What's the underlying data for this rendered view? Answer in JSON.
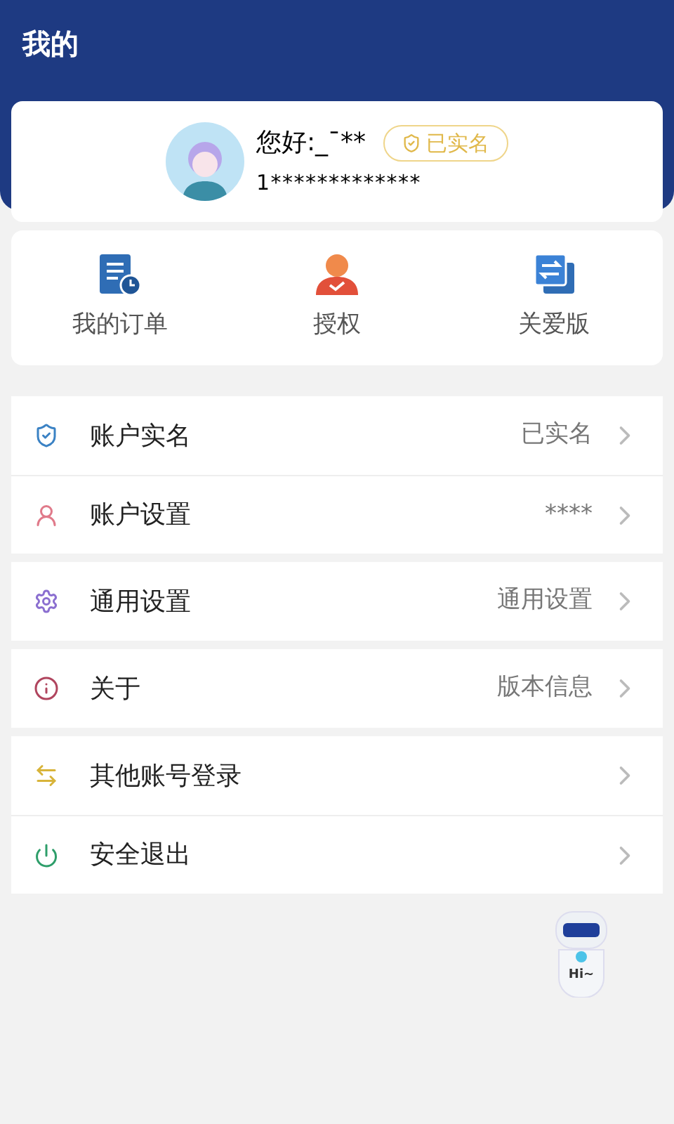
{
  "header": {
    "title": "我的"
  },
  "profile": {
    "greeting": "您好:_ˉ**",
    "verified": true,
    "badge": "已实名",
    "phone": "1*************"
  },
  "shortcuts": [
    {
      "label": "我的订单"
    },
    {
      "label": "授权"
    },
    {
      "label": "关爱版"
    }
  ],
  "menu_groups": [
    {
      "items": [
        {
          "label": "账户实名",
          "value": "已实名"
        },
        {
          "label": "账户设置",
          "value": "****"
        }
      ]
    },
    {
      "items": [
        {
          "label": "通用设置",
          "value": "通用设置"
        }
      ]
    },
    {
      "items": [
        {
          "label": "关于",
          "value": "版本信息"
        }
      ]
    },
    {
      "items": [
        {
          "label": "其他账号登录"
        },
        {
          "label": "安全退出"
        }
      ]
    }
  ],
  "assistant": {
    "label": "Hi~"
  }
}
